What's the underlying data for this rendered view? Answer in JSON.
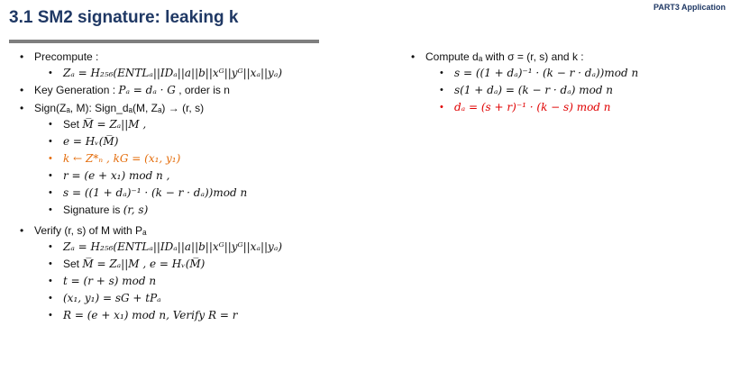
{
  "header": {
    "part_label": "PART3 Application",
    "title": "3.1  SM2 signature: leaking k"
  },
  "left": {
    "precompute_label": "Precompute :",
    "precompute_items": [
      "Zₐ = H₂₅₆(ENTLₐ||IDₐ||a||b||xᴳ||yᴳ||xₐ||yₐ)"
    ],
    "keygen": {
      "prefix": "Key Generation : ",
      "formula": "Pₐ = dₐ · G",
      "suffix": " , order is n"
    },
    "sign_label": "Sign(Zₐ, M): Sign_dₐ(M, Zₐ) → (r, s)",
    "sign_items": [
      {
        "prefix": "Set ",
        "formula": "M̅ = Zₐ||M ,",
        "color": "default"
      },
      {
        "prefix": "",
        "formula": "e = Hᵥ(M̅)",
        "color": "default"
      },
      {
        "prefix": "",
        "formula": "k ← Z*ₙ ,  kG = (x₁, y₁)",
        "color": "orange"
      },
      {
        "prefix": "",
        "formula": "r = (e + x₁) mod n ,",
        "color": "default"
      },
      {
        "prefix": "",
        "formula": "s = ((1 + dₐ)⁻¹ · (k − r · dₐ))mod n",
        "color": "default"
      },
      {
        "prefix": "Signature is ",
        "formula": "(r, s)",
        "color": "default"
      }
    ],
    "verify_label": "Verify (r, s) of M with Pₐ",
    "verify_items": [
      {
        "prefix": "",
        "formula": "Zₐ = H₂₅₆(ENTLₐ||IDₐ||a||b||xᴳ||yᴳ||xₐ||yₐ)"
      },
      {
        "prefix": "Set ",
        "formula": "M̅ = Zₐ||M ,  e = Hᵥ(M̅)"
      },
      {
        "prefix": "",
        "formula": "t = (r + s) mod n"
      },
      {
        "prefix": "",
        "formula": "(x₁, y₁) = sG + tPₐ"
      },
      {
        "prefix": "",
        "formula": "R = (e + x₁) mod n,  Verify R = r"
      }
    ]
  },
  "right": {
    "compute_label": "Compute dₐ with σ = (r, s) and k :",
    "compute_items": [
      {
        "formula": "s = ((1 + dₐ)⁻¹ · (k − r · dₐ))mod n",
        "color": "default"
      },
      {
        "formula": "s(1 + dₐ) = (k − r · dₐ) mod n",
        "color": "default"
      },
      {
        "formula": "dₐ = (s + r)⁻¹ · (k − s) mod n",
        "color": "red"
      }
    ]
  },
  "colors": {
    "title": "#1f3864",
    "title_bar": "#7f7f7f",
    "highlight_orange": "#e46c0a",
    "highlight_red": "#e00000"
  }
}
